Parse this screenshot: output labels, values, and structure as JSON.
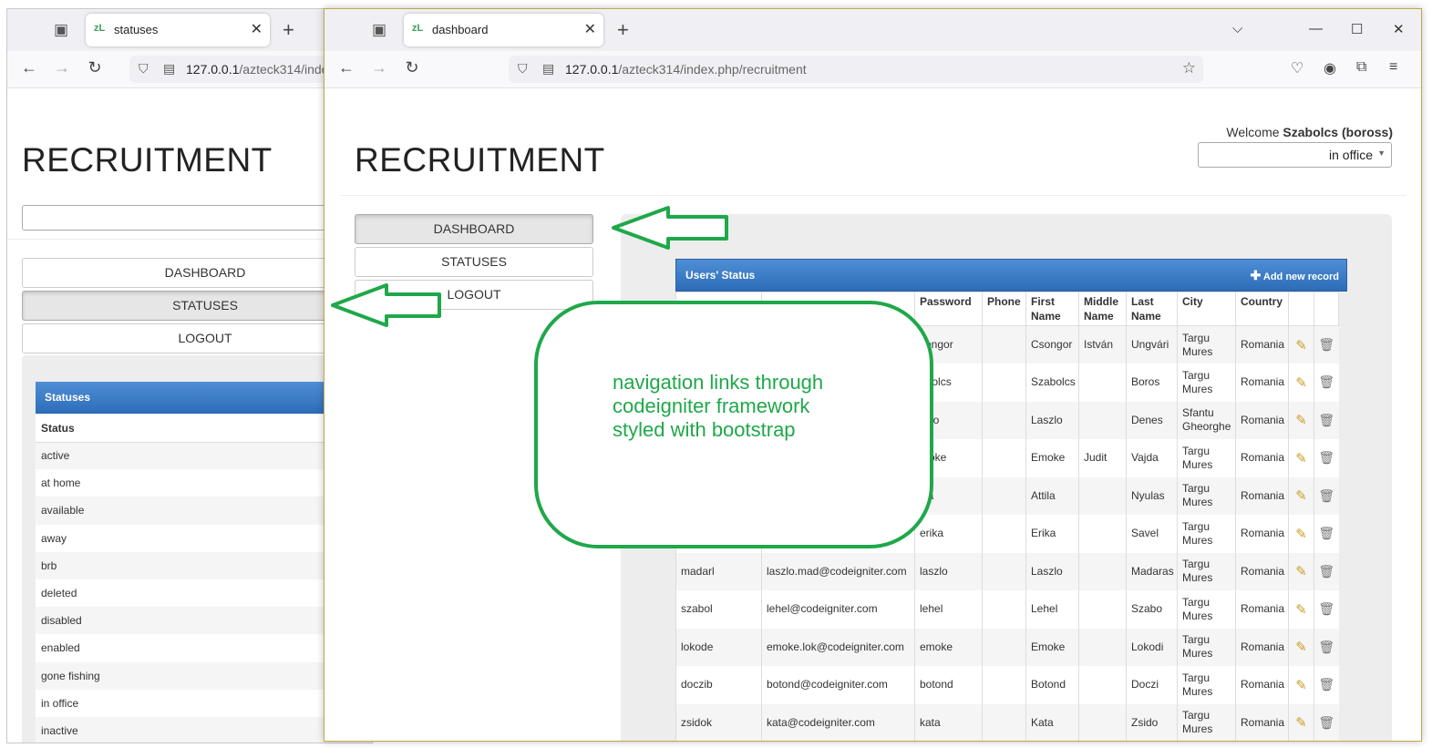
{
  "back_window": {
    "tab_title": "statuses",
    "url_host": "127.0.0.1",
    "url_path": "/azteck314/index",
    "page_title": "RECRUITMENT",
    "menu": [
      "DASHBOARD",
      "STATUSES",
      "LOGOUT"
    ],
    "panel_title": "Statuses",
    "column_header": "Status",
    "statuses": [
      "active",
      "at home",
      "available",
      "away",
      "brb",
      "deleted",
      "disabled",
      "enabled",
      "gone fishing",
      "in office",
      "inactive"
    ]
  },
  "front_window": {
    "tab_title": "dashboard",
    "url_host": "127.0.0.1",
    "url_path": "/azteck314/index.php/recruitment",
    "page_title": "RECRUITMENT",
    "welcome_prefix": "Welcome",
    "welcome_user": "Szabolcs (boross)",
    "status_select": "in office",
    "menu": [
      "DASHBOARD",
      "STATUSES",
      "LOGOUT"
    ],
    "panel_title": "Users' Status",
    "add_record": "Add new record",
    "columns": [
      "",
      "",
      "Password",
      "Phone",
      "First Name",
      "Middle Name",
      "Last Name",
      "City",
      "Country",
      "",
      ""
    ],
    "rows": [
      {
        "username": "",
        "email": "",
        "password": "songor",
        "phone": "",
        "first": "Csongor",
        "middle": "István",
        "last": "Ungvári",
        "city": "Targu Mures",
        "country": "Romania"
      },
      {
        "username": "",
        "email": "",
        "password": "abolcs",
        "phone": "",
        "first": "Szabolcs",
        "middle": "",
        "last": "Boros",
        "city": "Targu Mures",
        "country": "Romania"
      },
      {
        "username": "",
        "email": "",
        "password": "szlo",
        "phone": "",
        "first": "Laszlo",
        "middle": "",
        "last": "Denes",
        "city": "Sfantu Gheorghe",
        "country": "Romania"
      },
      {
        "username": "",
        "email": "",
        "password": "moke",
        "phone": "",
        "first": "Emoke",
        "middle": "Judit",
        "last": "Vajda",
        "city": "Targu Mures",
        "country": "Romania"
      },
      {
        "username": "",
        "email": "",
        "password": "tila",
        "phone": "",
        "first": "Attila",
        "middle": "",
        "last": "Nyulas",
        "city": "Targu Mures",
        "country": "Romania"
      },
      {
        "username": "",
        "email": "",
        "password": "erika",
        "phone": "",
        "first": "Erika",
        "middle": "",
        "last": "Savel",
        "city": "Targu Mures",
        "country": "Romania"
      },
      {
        "username": "madarl",
        "email": "laszlo.mad@codeigniter.com",
        "password": "laszlo",
        "phone": "",
        "first": "Laszlo",
        "middle": "",
        "last": "Madaras",
        "city": "Targu Mures",
        "country": "Romania"
      },
      {
        "username": "szabol",
        "email": "lehel@codeigniter.com",
        "password": "lehel",
        "phone": "",
        "first": "Lehel",
        "middle": "",
        "last": "Szabo",
        "city": "Targu Mures",
        "country": "Romania"
      },
      {
        "username": "lokode",
        "email": "emoke.lok@codeigniter.com",
        "password": "emoke",
        "phone": "",
        "first": "Emoke",
        "middle": "",
        "last": "Lokodi",
        "city": "Targu Mures",
        "country": "Romania"
      },
      {
        "username": "doczib",
        "email": "botond@codeigniter.com",
        "password": "botond",
        "phone": "",
        "first": "Botond",
        "middle": "",
        "last": "Doczi",
        "city": "Targu Mures",
        "country": "Romania"
      },
      {
        "username": "zsidok",
        "email": "kata@codeigniter.com",
        "password": "kata",
        "phone": "",
        "first": "Kata",
        "middle": "",
        "last": "Zsido",
        "city": "Targu Mures",
        "country": "Romania"
      }
    ]
  },
  "callout": {
    "lines": [
      "navigation links through",
      "codeigniter framework",
      "styled with bootstrap"
    ]
  },
  "colors": {
    "annotation": "#1fa84a",
    "panel_header": "#3a7bc8"
  }
}
